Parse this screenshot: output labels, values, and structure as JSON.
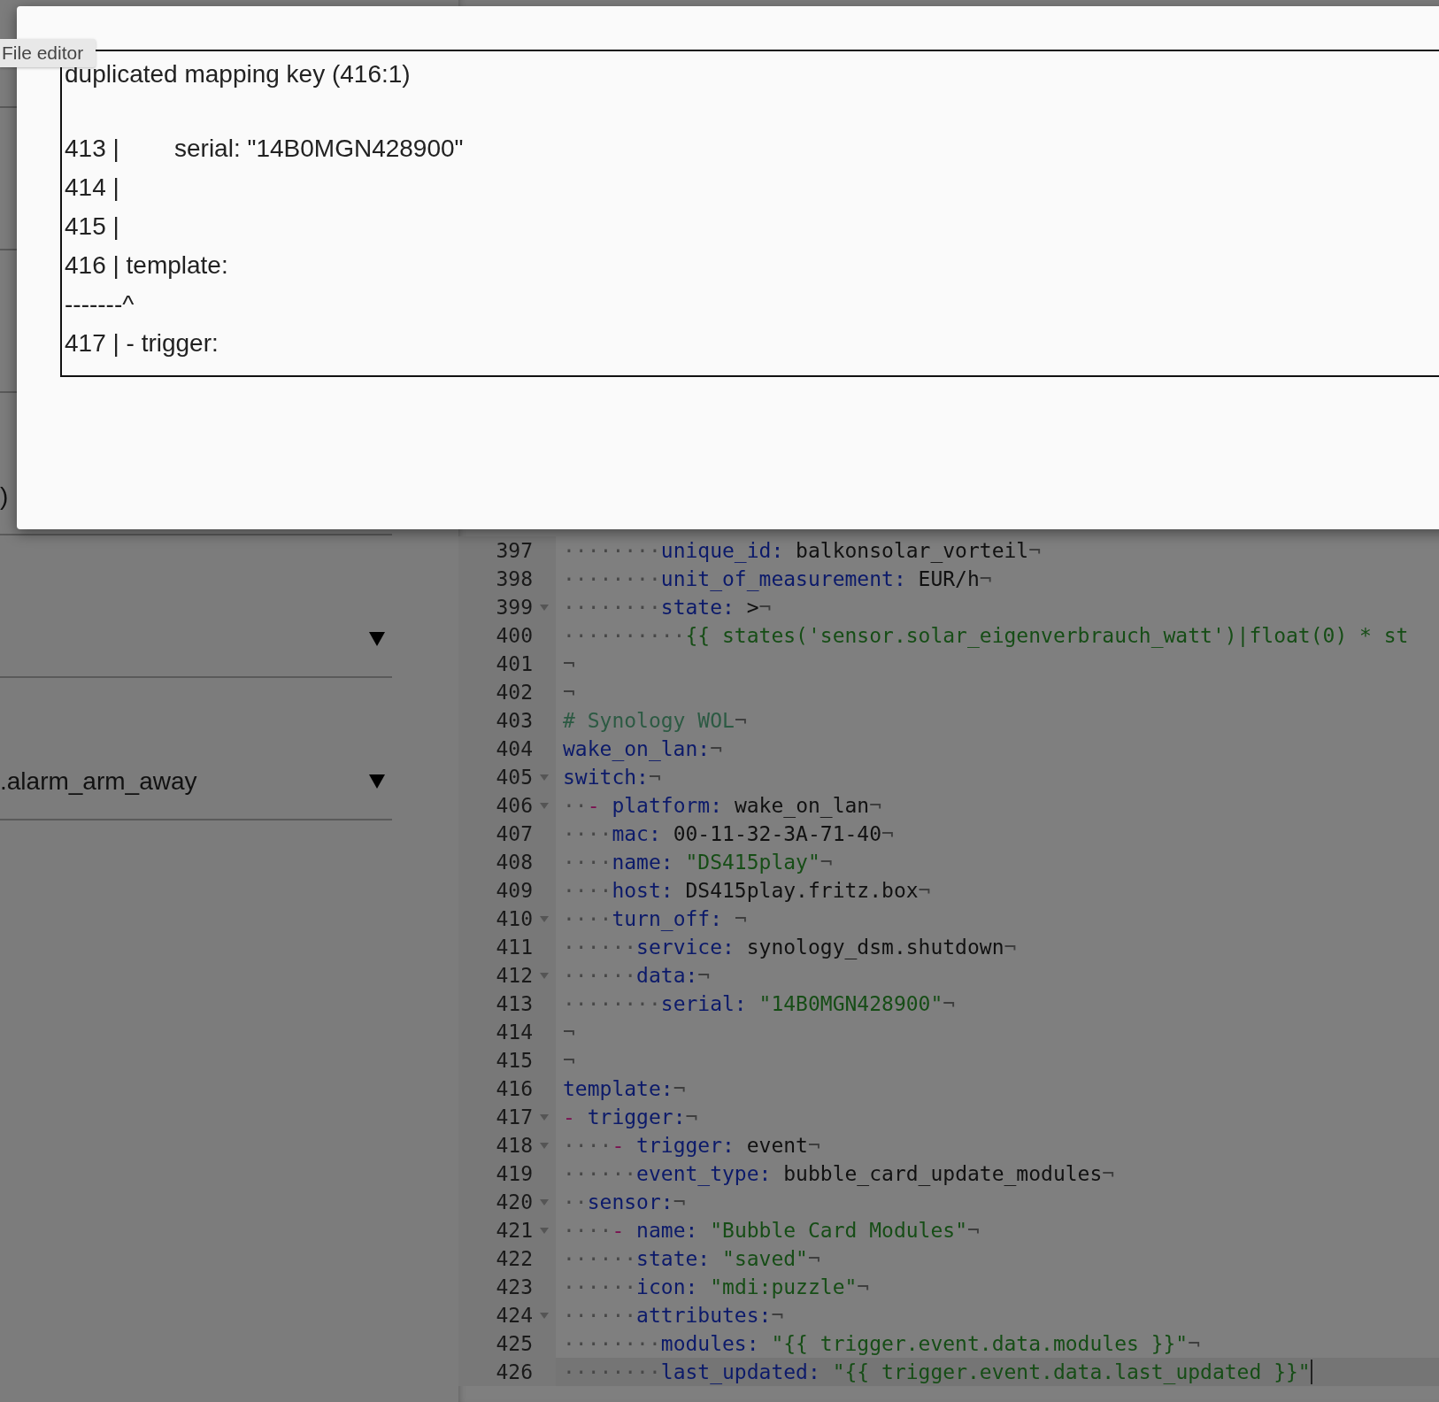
{
  "tooltip": {
    "label": "File editor"
  },
  "dialog": {
    "error_lines": [
      "duplicated mapping key (416:1)",
      "413 |        serial: \"14B0MGN428900\"",
      "414 |",
      "415 |",
      "416 | template:",
      "-------^",
      "417 | - trigger:"
    ]
  },
  "left_panel": {
    "fields": [
      {
        "kind": "text",
        "value": ")"
      },
      {
        "kind": "dropdown"
      },
      {
        "kind": "dropdown",
        "value": ".alarm_arm_away"
      }
    ]
  },
  "editor": {
    "lines": [
      {
        "num": "397",
        "fold": false,
        "selected": false,
        "tokens": [
          {
            "kind": "ws",
            "t": "········"
          },
          {
            "kind": "key",
            "t": "unique_id: "
          },
          {
            "kind": "plain",
            "t": "balkonsolar_vorteil"
          },
          {
            "kind": "eol",
            "t": "¬"
          }
        ]
      },
      {
        "num": "398",
        "fold": false,
        "selected": false,
        "tokens": [
          {
            "kind": "ws",
            "t": "········"
          },
          {
            "kind": "key",
            "t": "unit_of_measurement: "
          },
          {
            "kind": "plain",
            "t": "EUR/h"
          },
          {
            "kind": "eol",
            "t": "¬"
          }
        ]
      },
      {
        "num": "399",
        "fold": true,
        "selected": false,
        "tokens": [
          {
            "kind": "ws",
            "t": "········"
          },
          {
            "kind": "key",
            "t": "state: "
          },
          {
            "kind": "plain",
            "t": ">"
          },
          {
            "kind": "eol",
            "t": "¬"
          }
        ]
      },
      {
        "num": "400",
        "fold": false,
        "selected": false,
        "tokens": [
          {
            "kind": "ws",
            "t": "··········"
          },
          {
            "kind": "str",
            "t": "{{ states('sensor.solar_eigenverbrauch_watt')|float(0) * st"
          }
        ]
      },
      {
        "num": "401",
        "fold": false,
        "selected": false,
        "tokens": [
          {
            "kind": "eol",
            "t": "¬"
          }
        ]
      },
      {
        "num": "402",
        "fold": false,
        "selected": false,
        "tokens": [
          {
            "kind": "eol",
            "t": "¬"
          }
        ]
      },
      {
        "num": "403",
        "fold": false,
        "selected": false,
        "tokens": [
          {
            "kind": "comment",
            "t": "# Synology WOL"
          },
          {
            "kind": "eol",
            "t": "¬"
          }
        ]
      },
      {
        "num": "404",
        "fold": false,
        "selected": false,
        "tokens": [
          {
            "kind": "key",
            "t": "wake_on_lan:"
          },
          {
            "kind": "eol",
            "t": "¬"
          }
        ]
      },
      {
        "num": "405",
        "fold": true,
        "selected": false,
        "tokens": [
          {
            "kind": "key",
            "t": "switch:"
          },
          {
            "kind": "eol",
            "t": "¬"
          }
        ]
      },
      {
        "num": "406",
        "fold": true,
        "selected": false,
        "tokens": [
          {
            "kind": "ws",
            "t": "··"
          },
          {
            "kind": "dash",
            "t": "- "
          },
          {
            "kind": "key",
            "t": "platform: "
          },
          {
            "kind": "plain",
            "t": "wake_on_lan"
          },
          {
            "kind": "eol",
            "t": "¬"
          }
        ]
      },
      {
        "num": "407",
        "fold": false,
        "selected": false,
        "tokens": [
          {
            "kind": "ws",
            "t": "····"
          },
          {
            "kind": "key",
            "t": "mac: "
          },
          {
            "kind": "plain",
            "t": "00-11-32-3A-71-40"
          },
          {
            "kind": "eol",
            "t": "¬"
          }
        ]
      },
      {
        "num": "408",
        "fold": false,
        "selected": false,
        "tokens": [
          {
            "kind": "ws",
            "t": "····"
          },
          {
            "kind": "key",
            "t": "name: "
          },
          {
            "kind": "str",
            "t": "\"DS415play\""
          },
          {
            "kind": "eol",
            "t": "¬"
          }
        ]
      },
      {
        "num": "409",
        "fold": false,
        "selected": false,
        "tokens": [
          {
            "kind": "ws",
            "t": "····"
          },
          {
            "kind": "key",
            "t": "host: "
          },
          {
            "kind": "plain",
            "t": "DS415play.fritz.box"
          },
          {
            "kind": "eol",
            "t": "¬"
          }
        ]
      },
      {
        "num": "410",
        "fold": true,
        "selected": false,
        "tokens": [
          {
            "kind": "ws",
            "t": "····"
          },
          {
            "kind": "key",
            "t": "turn_off: "
          },
          {
            "kind": "eol",
            "t": "¬"
          }
        ]
      },
      {
        "num": "411",
        "fold": false,
        "selected": false,
        "tokens": [
          {
            "kind": "ws",
            "t": "······"
          },
          {
            "kind": "key",
            "t": "service: "
          },
          {
            "kind": "plain",
            "t": "synology_dsm.shutdown"
          },
          {
            "kind": "eol",
            "t": "¬"
          }
        ]
      },
      {
        "num": "412",
        "fold": true,
        "selected": false,
        "tokens": [
          {
            "kind": "ws",
            "t": "······"
          },
          {
            "kind": "key",
            "t": "data:"
          },
          {
            "kind": "eol",
            "t": "¬"
          }
        ]
      },
      {
        "num": "413",
        "fold": false,
        "selected": false,
        "tokens": [
          {
            "kind": "ws",
            "t": "········"
          },
          {
            "kind": "key",
            "t": "serial: "
          },
          {
            "kind": "str",
            "t": "\"14B0MGN428900\""
          },
          {
            "kind": "eol",
            "t": "¬"
          }
        ]
      },
      {
        "num": "414",
        "fold": false,
        "selected": false,
        "tokens": [
          {
            "kind": "eol",
            "t": "¬"
          }
        ]
      },
      {
        "num": "415",
        "fold": false,
        "selected": false,
        "tokens": [
          {
            "kind": "eol",
            "t": "¬"
          }
        ]
      },
      {
        "num": "416",
        "fold": false,
        "selected": false,
        "tokens": [
          {
            "kind": "key",
            "t": "template:"
          },
          {
            "kind": "eol",
            "t": "¬"
          }
        ]
      },
      {
        "num": "417",
        "fold": true,
        "selected": false,
        "tokens": [
          {
            "kind": "dash",
            "t": "- "
          },
          {
            "kind": "key",
            "t": "trigger:"
          },
          {
            "kind": "eol",
            "t": "¬"
          }
        ]
      },
      {
        "num": "418",
        "fold": true,
        "selected": false,
        "tokens": [
          {
            "kind": "ws",
            "t": "····"
          },
          {
            "kind": "dash",
            "t": "- "
          },
          {
            "kind": "key",
            "t": "trigger: "
          },
          {
            "kind": "plain",
            "t": "event"
          },
          {
            "kind": "eol",
            "t": "¬"
          }
        ]
      },
      {
        "num": "419",
        "fold": false,
        "selected": false,
        "tokens": [
          {
            "kind": "ws",
            "t": "······"
          },
          {
            "kind": "key",
            "t": "event_type: "
          },
          {
            "kind": "plain",
            "t": "bubble_card_update_modules"
          },
          {
            "kind": "eol",
            "t": "¬"
          }
        ]
      },
      {
        "num": "420",
        "fold": true,
        "selected": false,
        "tokens": [
          {
            "kind": "ws",
            "t": "··"
          },
          {
            "kind": "key",
            "t": "sensor:"
          },
          {
            "kind": "eol",
            "t": "¬"
          }
        ]
      },
      {
        "num": "421",
        "fold": true,
        "selected": false,
        "tokens": [
          {
            "kind": "ws",
            "t": "····"
          },
          {
            "kind": "dash",
            "t": "- "
          },
          {
            "kind": "key",
            "t": "name: "
          },
          {
            "kind": "str",
            "t": "\"Bubble Card Modules\""
          },
          {
            "kind": "eol",
            "t": "¬"
          }
        ]
      },
      {
        "num": "422",
        "fold": false,
        "selected": false,
        "tokens": [
          {
            "kind": "ws",
            "t": "······"
          },
          {
            "kind": "key",
            "t": "state: "
          },
          {
            "kind": "str",
            "t": "\"saved\""
          },
          {
            "kind": "eol",
            "t": "¬"
          }
        ]
      },
      {
        "num": "423",
        "fold": false,
        "selected": false,
        "tokens": [
          {
            "kind": "ws",
            "t": "······"
          },
          {
            "kind": "key",
            "t": "icon: "
          },
          {
            "kind": "str",
            "t": "\"mdi:puzzle\""
          },
          {
            "kind": "eol",
            "t": "¬"
          }
        ]
      },
      {
        "num": "424",
        "fold": true,
        "selected": false,
        "tokens": [
          {
            "kind": "ws",
            "t": "······"
          },
          {
            "kind": "key",
            "t": "attributes:"
          },
          {
            "kind": "eol",
            "t": "¬"
          }
        ]
      },
      {
        "num": "425",
        "fold": false,
        "selected": false,
        "tokens": [
          {
            "kind": "ws",
            "t": "········"
          },
          {
            "kind": "key",
            "t": "modules: "
          },
          {
            "kind": "str",
            "t": "\"{{ trigger.event.data.modules }}\""
          },
          {
            "kind": "eol",
            "t": "¬"
          }
        ]
      },
      {
        "num": "426",
        "fold": false,
        "selected": true,
        "tokens": [
          {
            "kind": "ws",
            "t": "········"
          },
          {
            "kind": "key",
            "t": "last_updated: "
          },
          {
            "kind": "str",
            "t": "\"{{ trigger.event.data.last_updated }}\""
          }
        ]
      }
    ]
  }
}
